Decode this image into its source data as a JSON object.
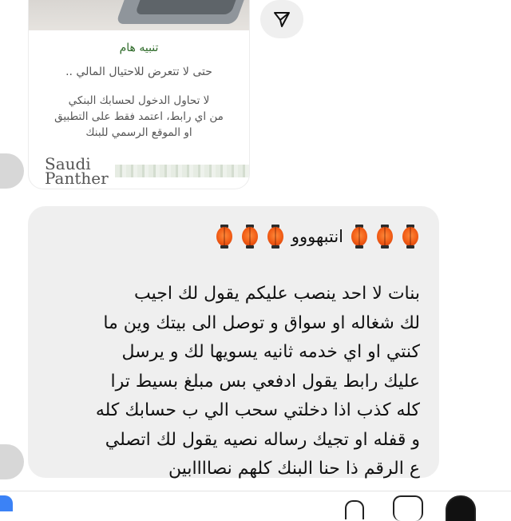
{
  "shared_post": {
    "title": "تنبيه هام",
    "subtitle": "حتى لا تتعرض للاحتيال المالي ..",
    "body_lines": [
      "لا تحاول الدخول لحسابك البنكي",
      "من اي رابط، اعتمد فقط على التطبيق",
      "او الموقع الرسمي للبنك"
    ],
    "brand": "Saudi Panther"
  },
  "message": {
    "header_text": "انتبهووو",
    "lines": [
      "بنات لا احد ينصب عليكم يقول   لك اجيب",
      "لك شغاله او سواق و توصل الى بيتك وين ما",
      "كنتي او اي خدمه ثانيه يسويها لك و يرسل",
      "عليك رابط يقول ادفعي بس مبلغ بسيط ترا",
      "كله كذب اذا دخلتي سحب الي ب حسابك كله",
      "و قفله او تجيك رساله نصيه يقول لك اتصلي",
      "ع الرقم ذا حنا البنك كلهم نصاااابين"
    ]
  },
  "icons": {
    "share": "send-icon",
    "lantern": "lantern-emoji",
    "mic": "microphone-icon",
    "gallery": "gallery-icon",
    "sticker": "sticker-icon"
  },
  "colors": {
    "bubble_bg": "#efefef",
    "alert_title": "#2f6b2a",
    "lantern": "#f05a14"
  }
}
